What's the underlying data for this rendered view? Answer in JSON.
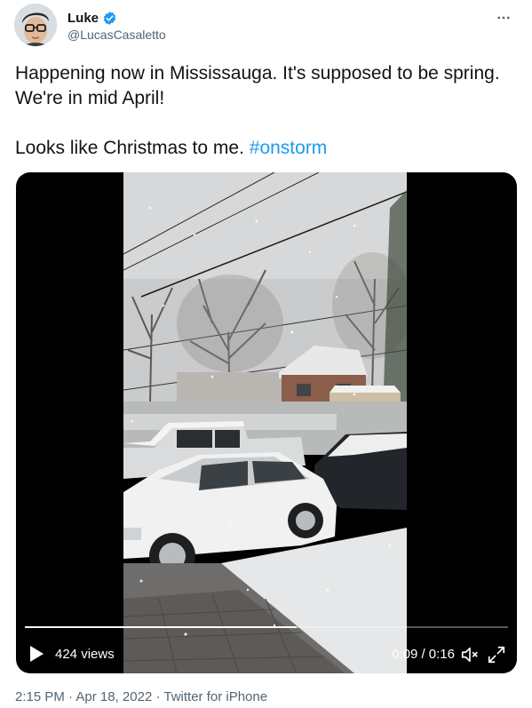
{
  "author": {
    "display_name": "Luke",
    "handle": "@LucasCasaletto",
    "verified_icon": "verified-badge-icon",
    "avatar_icon": "avatar"
  },
  "tweet": {
    "text_main": "Happening now in Mississauga. It's supposed to be spring. We're in mid April!\n\nLooks like Christmas to me. ",
    "hashtag": "#onstorm"
  },
  "video": {
    "views": "424 views",
    "time": "0:09 / 0:16",
    "progress": 0.5625
  },
  "meta": {
    "time": "2:15 PM",
    "separator1": " · ",
    "date": "Apr 18, 2022",
    "separator2": " · ",
    "source": "Twitter for iPhone"
  },
  "colors": {
    "accent": "#1d9bf0",
    "text": "#0f1419",
    "secondary": "#536471"
  }
}
